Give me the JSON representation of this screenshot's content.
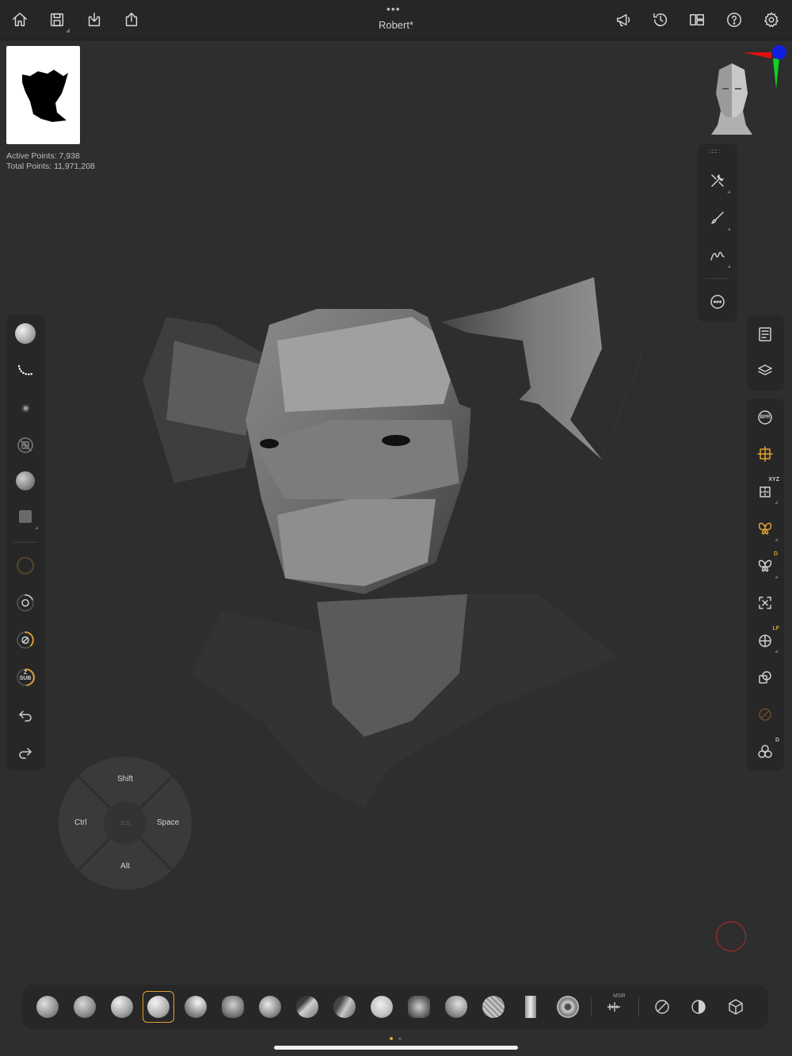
{
  "window": {
    "title": "Robert*",
    "menu_dots": "•••"
  },
  "top_left_buttons": [
    {
      "name": "home-icon"
    },
    {
      "name": "save-icon"
    },
    {
      "name": "import-icon"
    },
    {
      "name": "share-icon"
    }
  ],
  "top_right_buttons": [
    {
      "name": "megaphone-icon"
    },
    {
      "name": "history-icon"
    },
    {
      "name": "layout-icon"
    },
    {
      "name": "help-icon"
    },
    {
      "name": "gear-icon"
    }
  ],
  "stats": {
    "active": "Active Points: 7,938",
    "total": "Total Points: 11,971,208"
  },
  "right_tools": [
    "tool-icon",
    "brush-icon",
    "stroke-icon",
    "more-icon"
  ],
  "right_panel": {
    "bpr_label": "BPR",
    "xyz_badge": "XYZ",
    "d_badge": "D",
    "lf_badge": "LF",
    "d2_badge": "D"
  },
  "left_panel": {
    "zsub_label": "Z\nSUB",
    "zsub_top": "Z",
    "zsub_bottom": "SUB"
  },
  "dial": {
    "top": "Shift",
    "left": "Ctrl",
    "right": "Space",
    "bottom": "Alt"
  },
  "bottom_bar": {
    "msr_label": "MSR"
  },
  "colors": {
    "accent": "#e0a030",
    "record": "#c0262a",
    "gizmo_x": "#e01010",
    "gizmo_y": "#10d020",
    "gizmo_z": "#1020e0"
  }
}
